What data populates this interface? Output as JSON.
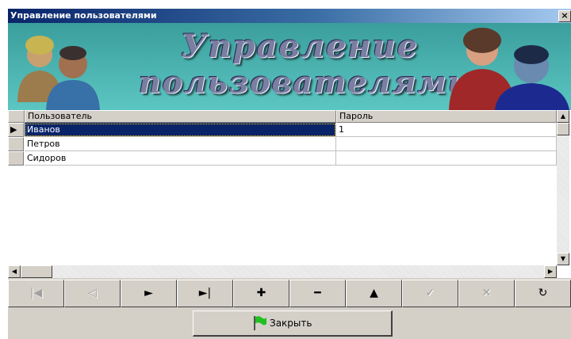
{
  "window": {
    "title": "Управление пользователями",
    "close_glyph": "×"
  },
  "banner": {
    "line1": "Управление",
    "line2": "пользователями"
  },
  "grid": {
    "columns": [
      "Пользователь",
      "Пароль"
    ],
    "rows": [
      {
        "user": "Иванов",
        "password": "1",
        "selected": true
      },
      {
        "user": "Петров",
        "password": "",
        "selected": false
      },
      {
        "user": "Сидоров",
        "password": "",
        "selected": false
      }
    ],
    "row_pointer": "▶"
  },
  "scroll": {
    "up": "▲",
    "down": "▼",
    "left": "◀",
    "right": "▶"
  },
  "navigator": {
    "buttons": [
      {
        "name": "first-record-button",
        "glyph": "|◀",
        "enabled": false
      },
      {
        "name": "prior-record-button",
        "glyph": "◁",
        "enabled": false
      },
      {
        "name": "next-record-button",
        "glyph": "►",
        "enabled": true
      },
      {
        "name": "last-record-button",
        "glyph": "►|",
        "enabled": true
      },
      {
        "name": "insert-record-button",
        "glyph": "✚",
        "enabled": true
      },
      {
        "name": "delete-record-button",
        "glyph": "━",
        "enabled": true
      },
      {
        "name": "edit-record-button",
        "glyph": "▲",
        "enabled": true
      },
      {
        "name": "post-record-button",
        "glyph": "✓",
        "enabled": false
      },
      {
        "name": "cancel-record-button",
        "glyph": "✕",
        "enabled": false
      },
      {
        "name": "refresh-button",
        "glyph": "↻",
        "enabled": true
      }
    ]
  },
  "close_button": {
    "label": "Закрыть",
    "icon": "green-flag-icon",
    "flag_color": "#20c020"
  },
  "colors": {
    "title_bar": "#0a246a",
    "banner": "#4fb6b3",
    "selection": "#0a246a"
  }
}
